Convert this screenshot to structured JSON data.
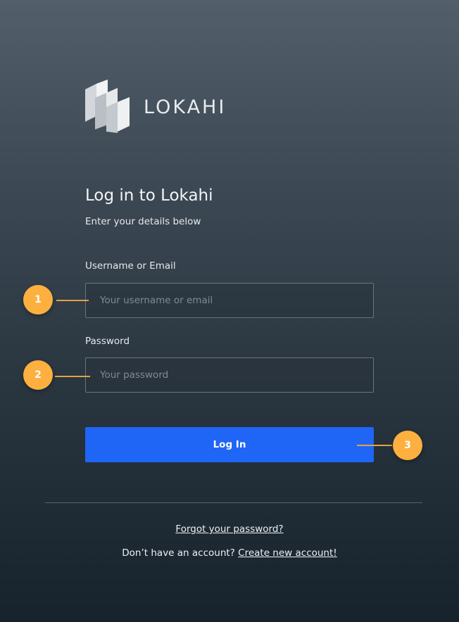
{
  "brand": {
    "name": "LOKAHI"
  },
  "heading": {
    "title": "Log in to Lokahi",
    "subtitle": "Enter your details below"
  },
  "form": {
    "username_label": "Username or Email",
    "username_placeholder": "Your username or email",
    "username_value": "",
    "password_label": "Password",
    "password_placeholder": "Your password",
    "password_value": "",
    "submit_label": "Log In"
  },
  "links": {
    "forgot_password": "Forgot your password?",
    "signup_prompt": "Don’t have an account?",
    "signup_link": "Create new account!"
  },
  "annotations": {
    "marker_1": "1",
    "marker_2": "2",
    "marker_3": "3"
  },
  "colors": {
    "primary_button": "#1f66f7",
    "marker": "#fdb03f",
    "background_top": "#525e69",
    "background_bottom": "#17232c"
  },
  "icons": {
    "logo": "lokahi-logo-icon"
  }
}
